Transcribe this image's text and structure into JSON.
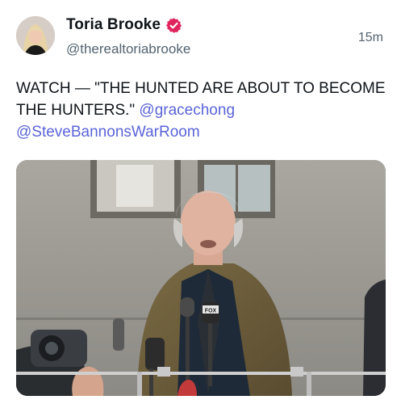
{
  "author": {
    "display_name": "Toria Brooke",
    "handle": "@therealtoriabrooke",
    "verified_icon": "verified-badge-icon",
    "avatar_icon": "profile-avatar"
  },
  "timestamp": "15m",
  "body": {
    "text": "WATCH — \"THE HUNTED ARE ABOUT TO BECOME THE HUNTERS.\" ",
    "mentions": [
      "@gracechong",
      "@SteveBannonsWarRoom"
    ]
  },
  "media": {
    "type": "photo",
    "mic_flag_text": "FOX"
  },
  "colors": {
    "mention": "#5a64d8",
    "verified": "#e0245e",
    "secondary_text": "#536471"
  }
}
